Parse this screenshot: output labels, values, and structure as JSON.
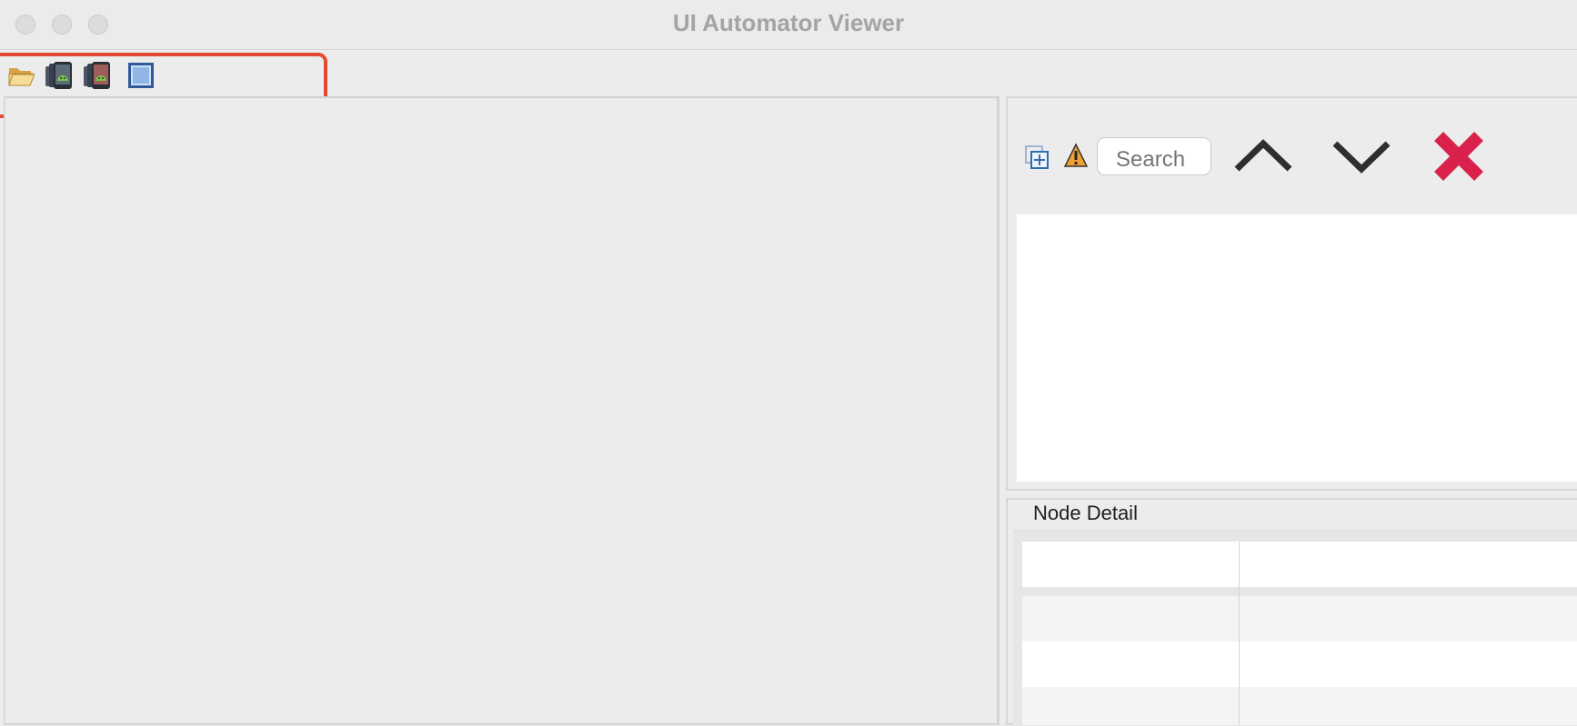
{
  "window": {
    "title": "UI Automator Viewer"
  },
  "toolbar": {
    "buttons": [
      {
        "icon": "open-folder-icon"
      },
      {
        "icon": "device-screenshot-icon"
      },
      {
        "icon": "device-screenshot-compressed-icon"
      },
      {
        "icon": "save-icon"
      }
    ]
  },
  "hierarchy": {
    "search_placeholder": "Search",
    "icons": [
      "expand-all-icon",
      "warning-icon",
      "up-arrow-icon",
      "down-arrow-icon",
      "clear-icon"
    ]
  },
  "node_detail": {
    "label": "Node Detail",
    "rows": [
      {
        "key": "",
        "value": ""
      },
      {
        "key": "",
        "value": ""
      },
      {
        "key": "",
        "value": ""
      },
      {
        "key": "",
        "value": ""
      }
    ]
  },
  "colors": {
    "highlight": "#e34a33",
    "clear": "#d9214b"
  }
}
